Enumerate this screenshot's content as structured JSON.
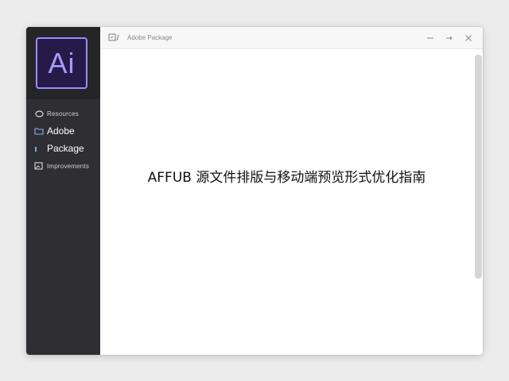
{
  "window": {
    "title": "Adobe Package",
    "controls": {
      "minimize": "—",
      "restore": "⤏",
      "close": "✕"
    }
  },
  "sidebar": {
    "logo_text": "Ai",
    "items": [
      {
        "label": "Resources",
        "icon": "circle-outline-icon",
        "style": "small"
      },
      {
        "label": "Adobe",
        "icon": "folder-icon",
        "style": "big"
      },
      {
        "label": "Package",
        "icon": "bar-icon",
        "style": "big"
      },
      {
        "label": "Improvements",
        "icon": "picture-icon",
        "style": "small"
      }
    ]
  },
  "main": {
    "headline": "AFFUB 源文件排版与移动端预览形式优化指南"
  },
  "colors": {
    "sidebar_bg": "#2f2f33",
    "logo_bg": "#261a48",
    "logo_accent": "#9a8cff"
  }
}
